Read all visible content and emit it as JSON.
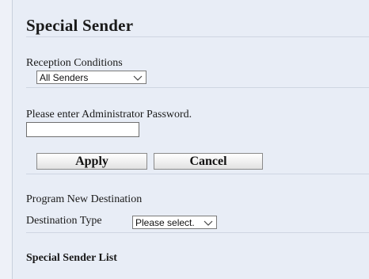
{
  "page": {
    "title": "Special Sender"
  },
  "reception": {
    "label": "Reception Conditions",
    "selected": "All Senders"
  },
  "password": {
    "label": "Please enter Administrator Password.",
    "value": ""
  },
  "buttons": {
    "apply": "Apply",
    "cancel": "Cancel"
  },
  "program": {
    "heading": "Program New Destination",
    "type_label": "Destination Type",
    "type_selected": "Please select."
  },
  "list": {
    "heading": "Special Sender List"
  },
  "icons": {
    "dropdown": "chevron-down-icon"
  }
}
